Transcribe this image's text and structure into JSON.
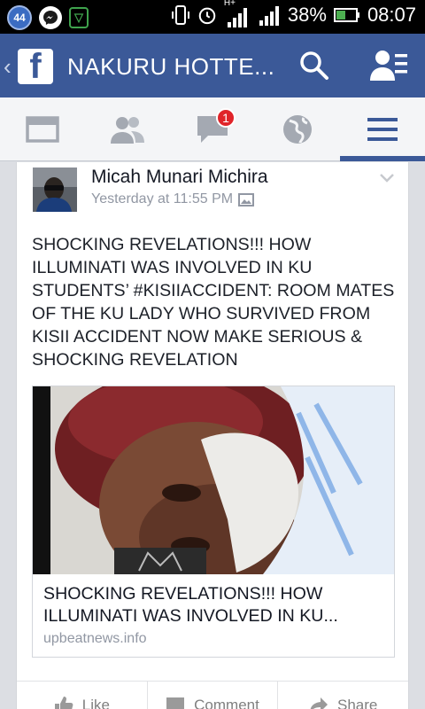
{
  "status_bar": {
    "notification_count": "44",
    "network_type": "H+",
    "battery_percent": "38%",
    "time": "08:07",
    "icons": [
      "notification-count-icon",
      "messenger-icon",
      "vpn-shield-icon",
      "vibrate-icon",
      "alarm-icon",
      "signal-icon",
      "signal-icon",
      "battery-icon"
    ]
  },
  "header": {
    "title": "NAKURU HOTTE...",
    "brand_color": "#3b5998",
    "icons": [
      "back-chevron-icon",
      "facebook-logo",
      "search-icon",
      "friend-requests-icon"
    ]
  },
  "tabs": [
    {
      "name": "news-feed",
      "icon": "news-feed-icon",
      "active": false
    },
    {
      "name": "friends",
      "icon": "friends-icon",
      "active": false
    },
    {
      "name": "messages",
      "icon": "messages-icon",
      "active": false,
      "badge": "1"
    },
    {
      "name": "notifications",
      "icon": "globe-icon",
      "active": false
    },
    {
      "name": "more",
      "icon": "menu-icon",
      "active": true
    }
  ],
  "post": {
    "author": "Micah Munari Michira",
    "timestamp": "Yesterday at 11:55 PM",
    "text_before_tag": "SHOCKING REVELATIONS!!! HOW ILLUMINATI WAS INVOLVED IN KU STUDENTS’ ",
    "hashtag": "#KISIIACCIDENT",
    "text_after_tag": ": ROOM MATES OF THE KU LADY WHO SURVIVED FROM KISII ACCIDENT NOW MAKE SERIOUS & SHOCKING REVELATION",
    "link": {
      "title": "SHOCKING REVELATIONS!!! HOW ILLUMINATI WAS INVOLVED IN KU...",
      "domain": "upbeatnews.info"
    },
    "actions": {
      "like": "Like",
      "comment": "Comment",
      "share": "Share"
    }
  }
}
